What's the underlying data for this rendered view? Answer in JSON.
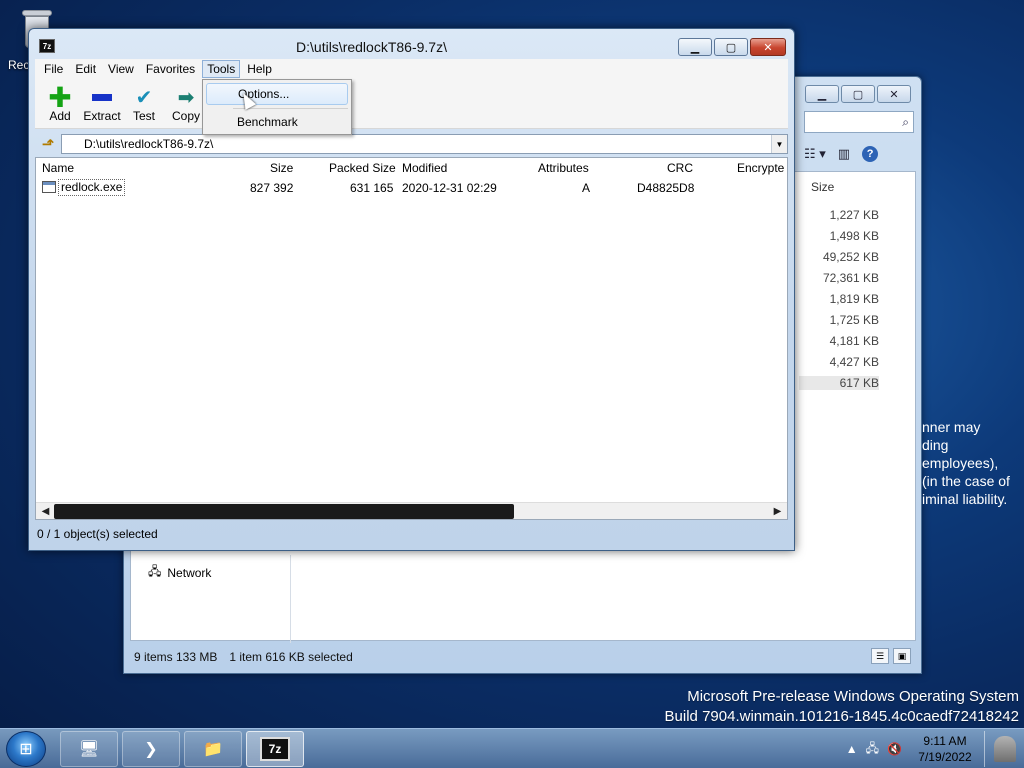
{
  "desktop": {
    "recycle_bin_label": "Rec",
    "watermark_line1": "Microsoft Pre-release Windows Operating System",
    "watermark_line2": "Build 7904.winmain.101216-1845.4c0caedf72418242"
  },
  "explorer": {
    "size_header": "Size",
    "sizes": [
      "1,227 KB",
      "1,498 KB",
      "49,252 KB",
      "72,361 KB",
      "1,819 KB",
      "1,725 KB",
      "4,181 KB",
      "4,427 KB",
      "617 KB"
    ],
    "side_text": [
      "nner may",
      "ding",
      "employees),",
      "(in the case of",
      "iminal liability."
    ],
    "network_label": "Network",
    "status_items": "9 items 133 MB",
    "status_selected": "1 item 616 KB selected"
  },
  "zip": {
    "title": "D:\\utils\\redlockT86-9.7z\\",
    "app_icon": "7z",
    "menu": [
      "File",
      "Edit",
      "View",
      "Favorites",
      "Tools",
      "Help"
    ],
    "toolbar": [
      {
        "label": "Add",
        "icon": "add-icon"
      },
      {
        "label": "Extract",
        "icon": "extract-icon"
      },
      {
        "label": "Test",
        "icon": "test-icon"
      },
      {
        "label": "Copy",
        "icon": "copy-icon"
      }
    ],
    "address": "D:\\utils\\redlockT86-9.7z\\",
    "columns": [
      "Name",
      "Size",
      "Packed Size",
      "Modified",
      "Attributes",
      "CRC",
      "Encrypte"
    ],
    "rows": [
      {
        "name": "redlock.exe",
        "size": "827 392",
        "packed": "631 165",
        "modified": "2020-12-31 02:29",
        "attributes": "A",
        "crc": "D48825D8"
      }
    ],
    "status": "0 / 1 object(s) selected",
    "tools_menu": [
      "Options...",
      "Benchmark"
    ]
  },
  "taskbar": {
    "zip_button": "7z",
    "time": "9:11 AM",
    "date": "7/19/2022"
  }
}
